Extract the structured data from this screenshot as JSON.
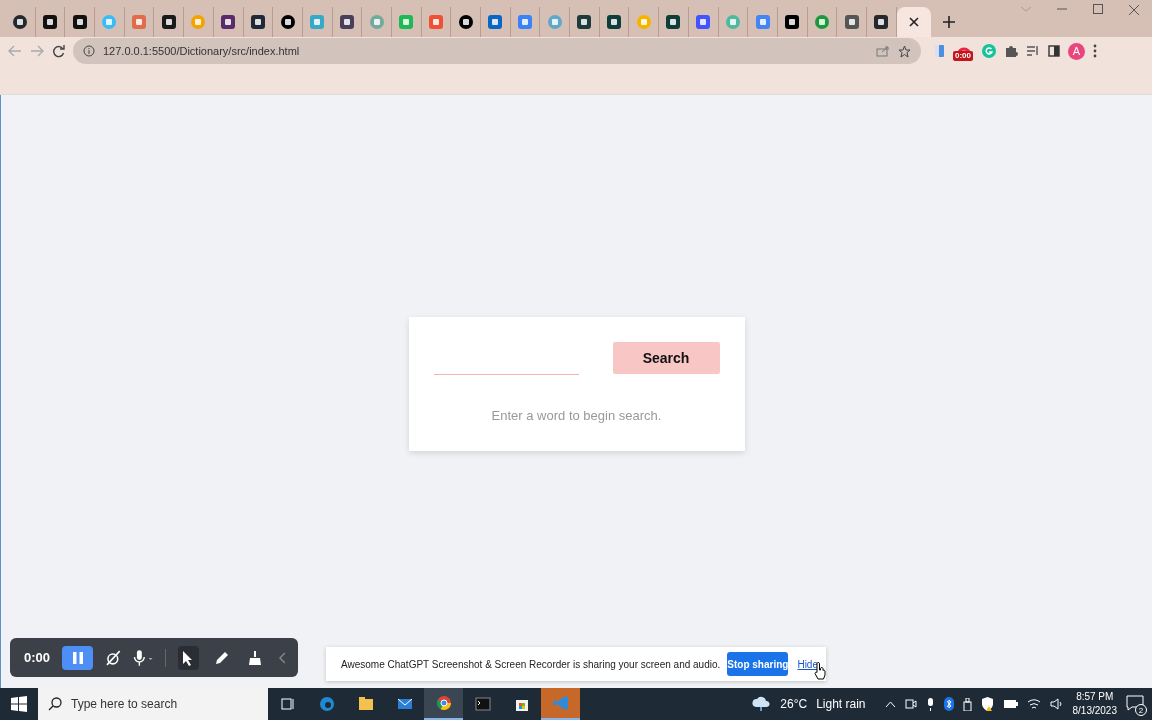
{
  "browser": {
    "tabs": [
      {
        "color": "#24292f",
        "selected": false
      },
      {
        "color": "#111111",
        "selected": false
      },
      {
        "color": "#111111",
        "selected": false
      },
      {
        "color": "#38bdf8",
        "selected": false
      },
      {
        "color": "#e06c4c",
        "selected": false
      },
      {
        "color": "#1a1a1a",
        "selected": false
      },
      {
        "color": "#f4a300",
        "selected": false
      },
      {
        "color": "#5a2a6a",
        "selected": false
      },
      {
        "color": "#1f2937",
        "selected": false
      },
      {
        "color": "#000000",
        "selected": false
      },
      {
        "color": "#36a8c8",
        "selected": false
      },
      {
        "color": "#4a3f5a",
        "selected": false
      },
      {
        "color": "#74aa9c",
        "selected": false
      },
      {
        "color": "#1db954",
        "selected": false
      },
      {
        "color": "#f05033",
        "selected": false
      },
      {
        "color": "#000000",
        "selected": false
      },
      {
        "color": "#0a66c2",
        "selected": false
      },
      {
        "color": "#3b82f6",
        "selected": false
      },
      {
        "color": "#61a8c8",
        "selected": false
      },
      {
        "color": "#1e3a3a",
        "selected": false
      },
      {
        "color": "#0f3d3a",
        "selected": false
      },
      {
        "color": "#f5b400",
        "selected": false
      },
      {
        "color": "#0f3d3a",
        "selected": false
      },
      {
        "color": "#4353ff",
        "selected": false
      },
      {
        "color": "#4fb8a0",
        "selected": false
      },
      {
        "color": "#4285f4",
        "selected": false
      },
      {
        "color": "#000000",
        "selected": false
      },
      {
        "color": "#1a9a3a",
        "selected": false
      },
      {
        "color": "#555555",
        "selected": false
      },
      {
        "color": "#24292f",
        "selected": false
      },
      {
        "color": "#f6e6df",
        "selected": true
      }
    ],
    "url": "127.0.0.1:5500/Dictionary/src/index.html",
    "recorder_badge": "0:00",
    "avatar": "A"
  },
  "page": {
    "search_button": "Search",
    "message": "Enter a word to begin search."
  },
  "recorder": {
    "time": "0:00",
    "tools": [
      {
        "selected": true
      },
      {
        "selected": false
      },
      {
        "selected": false
      }
    ]
  },
  "share_bar": {
    "message": "Awesome ChatGPT Screenshot & Screen Recorder is sharing your screen and audio.",
    "stop_button": "Stop sharing",
    "hide_link": "Hide"
  },
  "taskbar": {
    "search_placeholder": "Type here to search",
    "apps": [
      {
        "selected": false
      },
      {
        "selected": false
      },
      {
        "selected": false
      },
      {
        "selected": true
      },
      {
        "selected": false
      },
      {
        "selected": false
      },
      {
        "selected": true
      }
    ],
    "temperature": "26°C",
    "weather": "Light rain",
    "time": "8:57 PM",
    "date": "8/13/2023",
    "notifications": "2"
  }
}
